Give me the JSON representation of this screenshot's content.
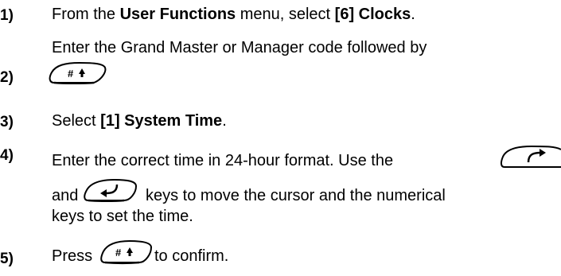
{
  "steps": [
    {
      "number": "1)",
      "pre": "From the ",
      "bold1": "User Functions",
      "mid": " menu, select ",
      "bold2": "[6] Clocks",
      "post": "."
    },
    {
      "number": "2)",
      "line1": "Enter the Grand Master or Manager code followed by",
      "key_glyph": "#↑"
    },
    {
      "number": "3)",
      "pre": "Select ",
      "bold": "[1] System Time",
      "post": "."
    },
    {
      "number": "4)",
      "line1": "Enter the correct time in 24-hour format. Use the",
      "line2_pre": "and",
      "line2_post": "keys to move the cursor and the numerical",
      "line3": "keys to set the time."
    },
    {
      "number": "5)",
      "pre": "Press",
      "post": "to confirm.",
      "key_glyph": "#↑"
    }
  ],
  "icons": {
    "enter_key": "hash-arrow-key-icon",
    "right_key": "right-arrow-key-icon",
    "left_key": "left-arrow-key-icon"
  }
}
